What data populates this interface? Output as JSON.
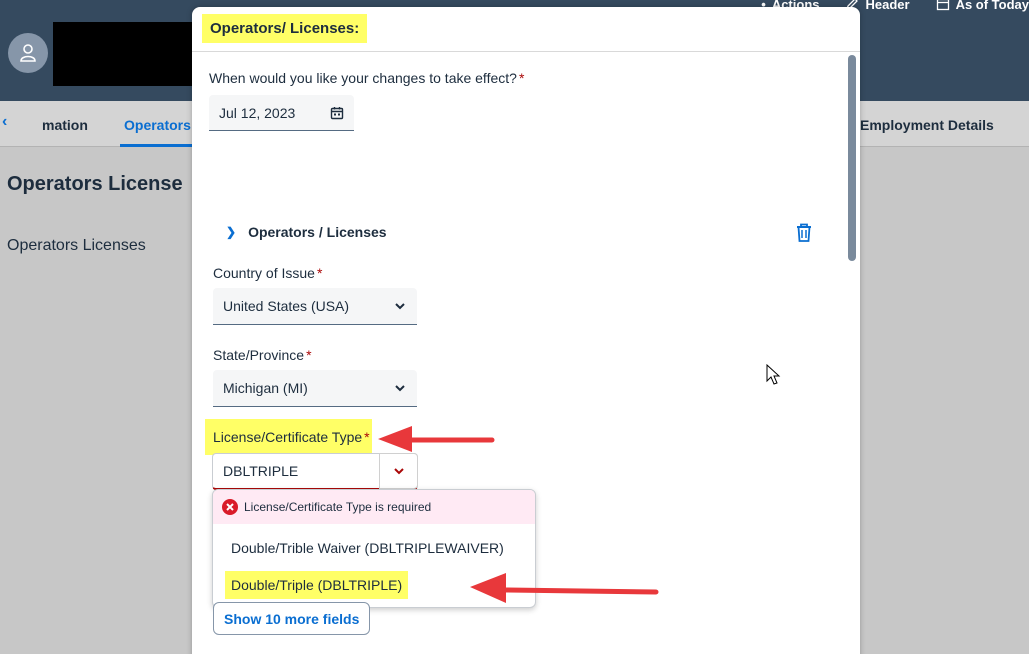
{
  "topbar": {
    "actions": [
      {
        "label": "Actions",
        "icon": "dots-icon"
      },
      {
        "label": "Header",
        "icon": "pencil-icon"
      },
      {
        "label": "As of Today",
        "icon": "calendar-icon"
      }
    ]
  },
  "tabs": {
    "back_icon": "chevron-left-icon",
    "items": [
      {
        "label": "mation"
      },
      {
        "label": "Operators"
      },
      {
        "label": "Employment Details"
      }
    ]
  },
  "page": {
    "title": "Operators License",
    "subtitle": "Operators Licenses"
  },
  "dialog": {
    "title": "Operators/ Licenses:",
    "effective_label": "When would you like your changes to take effect?",
    "effective_date": "Jul 12, 2023",
    "section_title": "Operators / Licenses",
    "country_label": "Country of Issue",
    "country_value": "United States (USA)",
    "state_label": "State/Province",
    "state_value": "Michigan (MI)",
    "license_label": "License/Certificate Type",
    "license_value": "DBLTRIPLE",
    "error_message": "License/Certificate Type is required",
    "options": [
      "Double/Trible Waiver (DBLTRIPLEWAIVER)",
      "Double/Triple (DBLTRIPLE)"
    ],
    "more_fields_label": "Show 10 more fields",
    "required_mark": "*"
  },
  "colors": {
    "shell": "#354a5f",
    "accent": "#0a6ed1",
    "error": "#aa0808",
    "highlight": "#ffff66",
    "annotation": "#e8383b"
  }
}
